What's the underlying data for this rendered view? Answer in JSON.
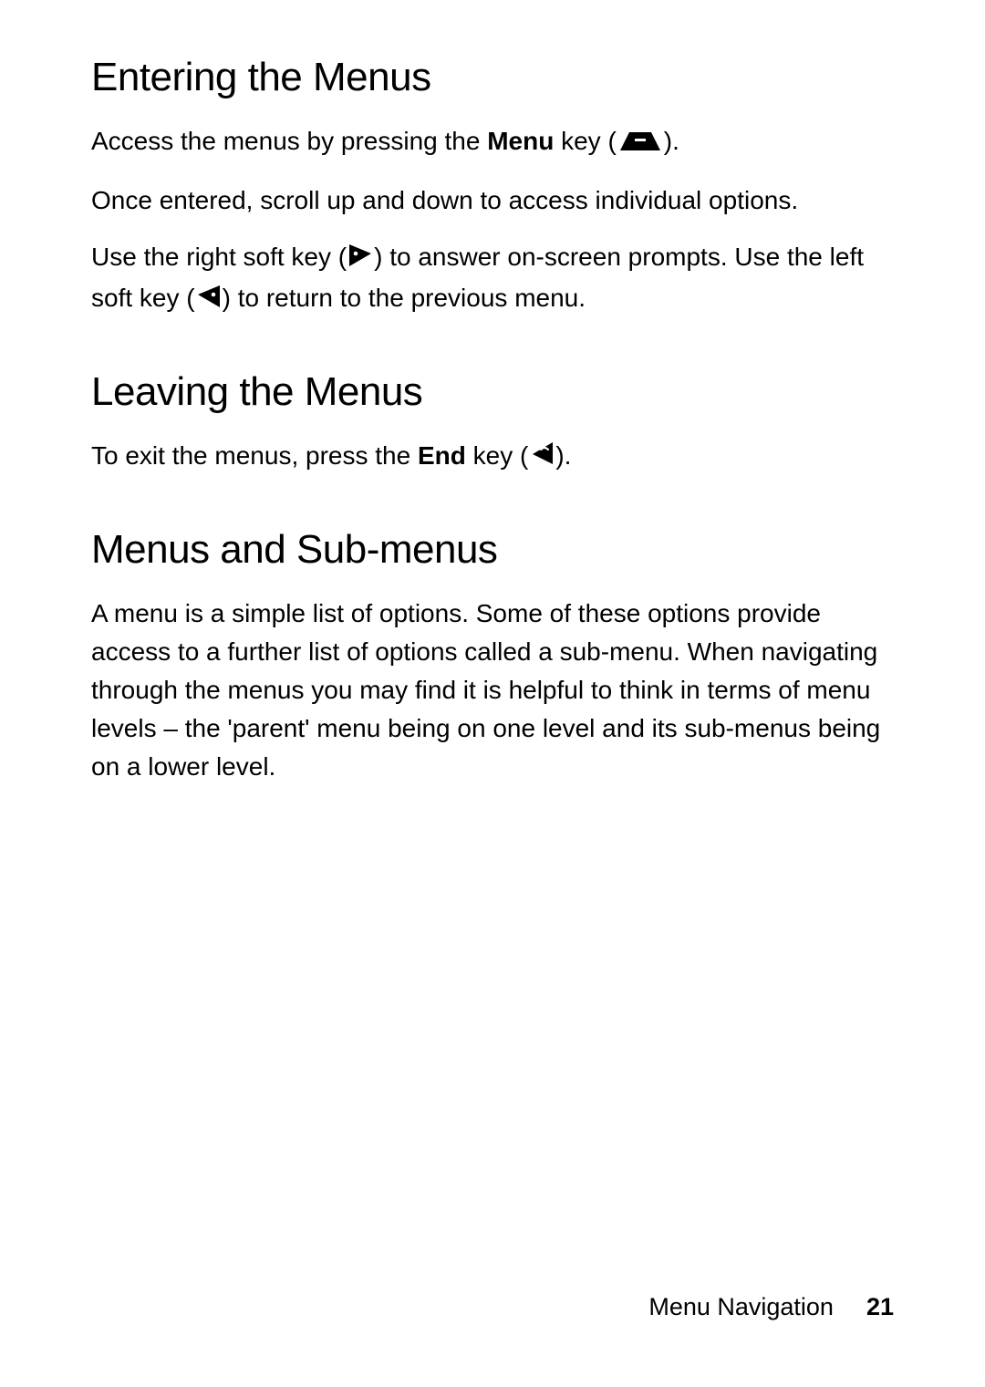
{
  "sections": {
    "entering": {
      "heading": "Entering the Menus",
      "p1_a": "Access the menus by pressing the ",
      "p1_b": "Menu",
      "p1_c": " key (",
      "p1_d": ").",
      "p2": "Once entered, scroll up and down to access individual options.",
      "p3_a": "Use the right soft key (",
      "p3_b": ") to answer on-screen prompts. Use the left soft key (",
      "p3_c": ") to return to the previous menu."
    },
    "leaving": {
      "heading": "Leaving the Menus",
      "p1_a": "To exit the menus, press the ",
      "p1_b": "End",
      "p1_c": " key (",
      "p1_d": ")."
    },
    "menus": {
      "heading": "Menus and Sub-menus",
      "p1": "A menu is a simple list of options. Some of these options provide access to a further list of options called a sub-menu. When navigating through the menus you may find it is helpful to think in terms of menu levels – the 'parent' menu being on one level and its sub-menus being on a lower level."
    }
  },
  "footer": {
    "label": "Menu Navigation",
    "page": "21"
  }
}
